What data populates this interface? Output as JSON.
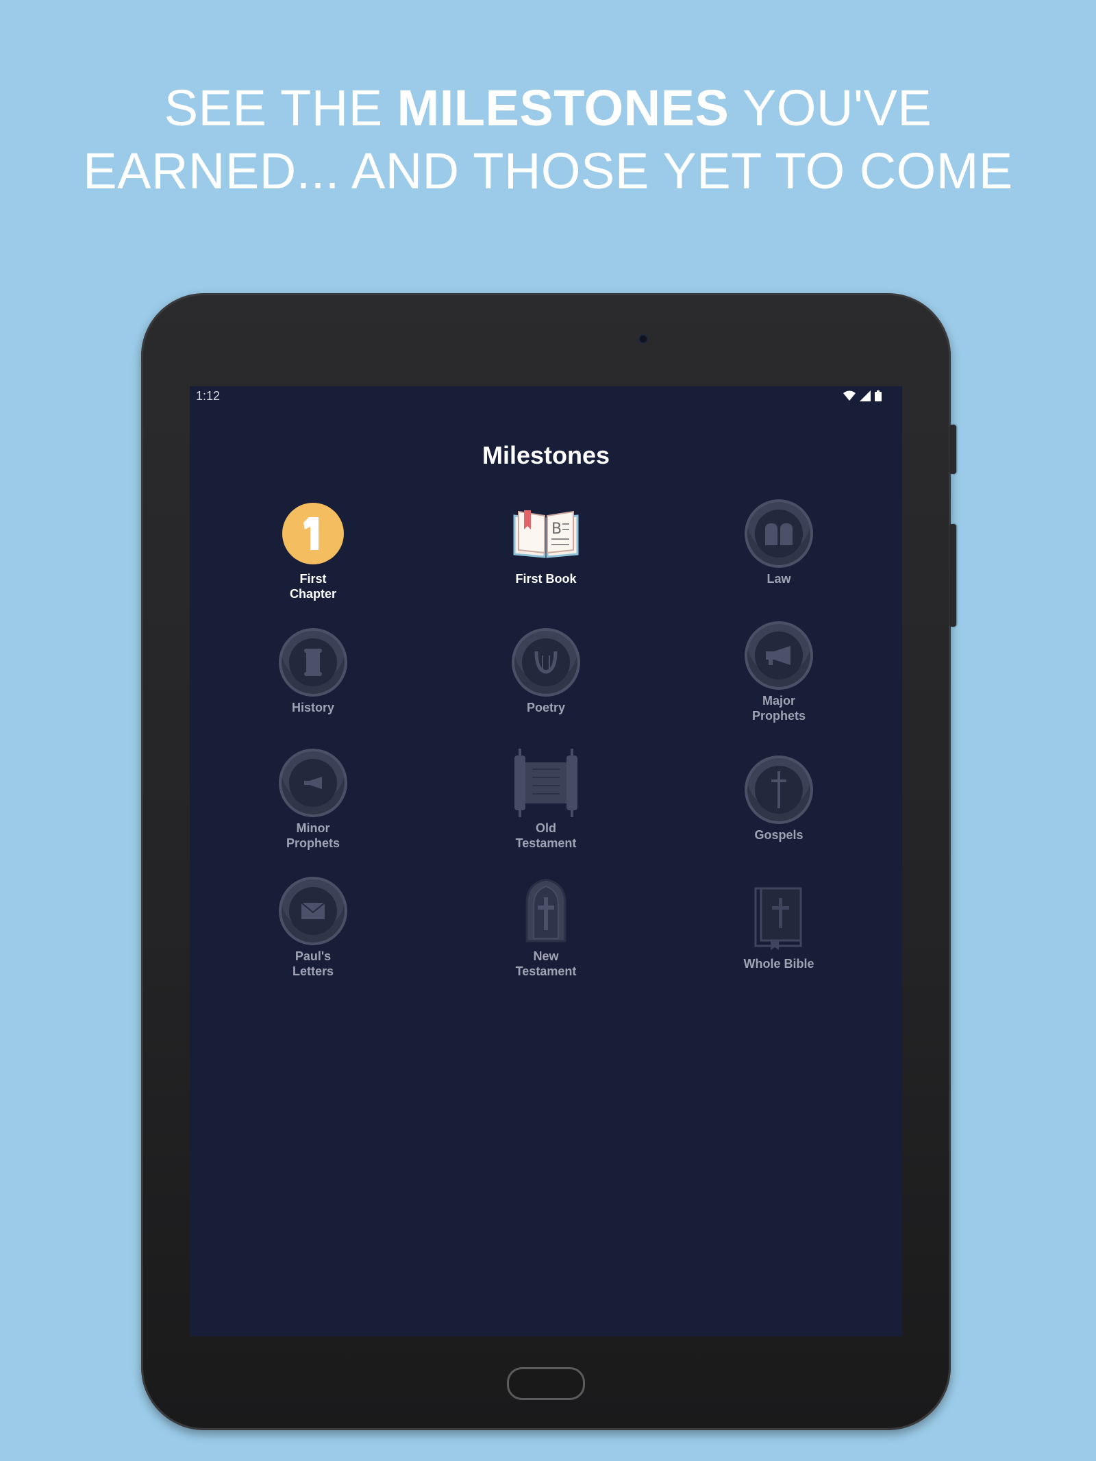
{
  "headline": {
    "part1": "SEE THE ",
    "bold": "MILESTONES",
    "part2": " YOU'VE",
    "line2": "EARNED... AND THOSE YET TO COME"
  },
  "status_bar": {
    "time": "1:12"
  },
  "page_title": "Milestones",
  "milestones": [
    {
      "label": "First\nChapter",
      "icon": "number-one-badge-icon",
      "earned": true
    },
    {
      "label": "First Book",
      "icon": "open-book-icon",
      "earned": true
    },
    {
      "label": "Law",
      "icon": "tablets-icon",
      "earned": false
    },
    {
      "label": "History",
      "icon": "scroll-icon",
      "earned": false
    },
    {
      "label": "Poetry",
      "icon": "lyre-icon",
      "earned": false
    },
    {
      "label": "Major\nProphets",
      "icon": "megaphone-icon",
      "earned": false
    },
    {
      "label": "Minor\nProphets",
      "icon": "small-megaphone-icon",
      "earned": false
    },
    {
      "label": "Old\nTestament",
      "icon": "torah-scroll-icon",
      "earned": false
    },
    {
      "label": "Gospels",
      "icon": "cross-icon",
      "earned": false
    },
    {
      "label": "Paul's\nLetters",
      "icon": "envelope-icon",
      "earned": false
    },
    {
      "label": "New\nTestament",
      "icon": "stained-glass-window-icon",
      "earned": false
    },
    {
      "label": "Whole Bible",
      "icon": "bible-icon",
      "earned": false
    }
  ],
  "colors": {
    "background": "#9bcbe8",
    "screen": "#181e37",
    "earned_gold": "#f4bd5f",
    "locked_medal": "#3b4157"
  }
}
